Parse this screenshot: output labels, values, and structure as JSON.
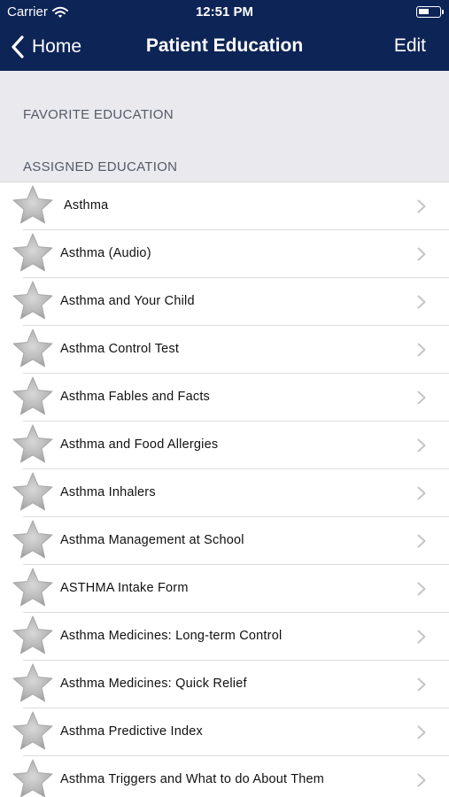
{
  "status_bar": {
    "carrier": "Carrier",
    "time": "12:51 PM"
  },
  "nav": {
    "back_label": "Home",
    "title": "Patient Education",
    "edit_label": "Edit"
  },
  "sections": {
    "favorite": "FAVORITE EDUCATION",
    "assigned": "ASSIGNED EDUCATION"
  },
  "colors": {
    "nav_background": "#0d2456",
    "section_background": "#e9e9ee"
  },
  "items": [
    {
      "label": "Asthma"
    },
    {
      "label": "Asthma (Audio)"
    },
    {
      "label": "Asthma and Your Child"
    },
    {
      "label": "Asthma Control Test"
    },
    {
      "label": "Asthma Fables and Facts"
    },
    {
      "label": "Asthma and Food Allergies"
    },
    {
      "label": "Asthma Inhalers"
    },
    {
      "label": "Asthma Management at School"
    },
    {
      "label": "ASTHMA Intake Form"
    },
    {
      "label": "Asthma Medicines: Long-term Control"
    },
    {
      "label": "Asthma Medicines: Quick Relief"
    },
    {
      "label": "Asthma Predictive Index"
    },
    {
      "label": "Asthma Triggers and What to do About Them"
    }
  ]
}
